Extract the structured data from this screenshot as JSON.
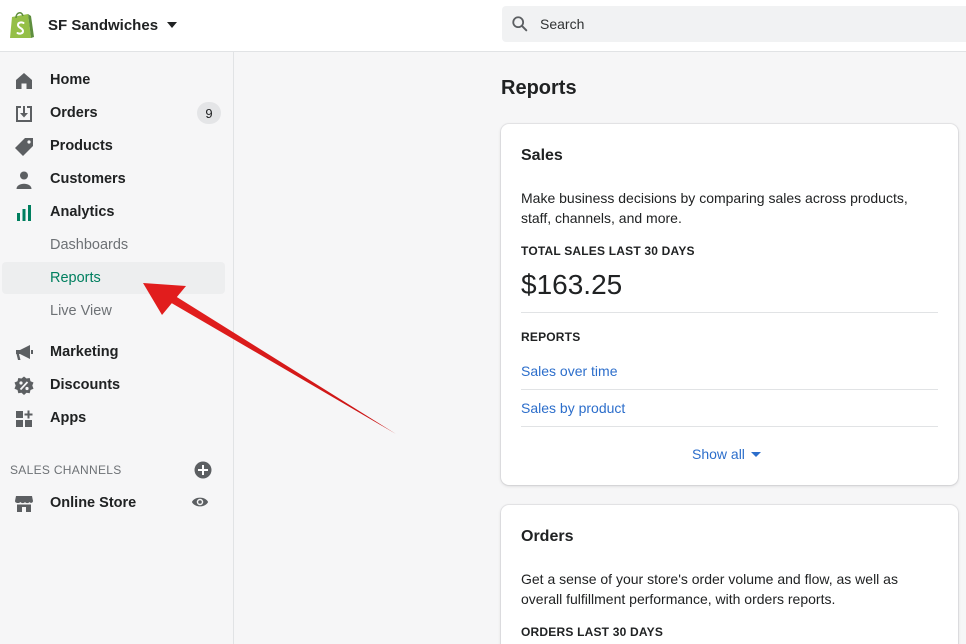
{
  "store": {
    "name": "SF Sandwiches"
  },
  "search": {
    "placeholder": "Search"
  },
  "sidebar": {
    "items": [
      {
        "label": "Home",
        "icon": "home-icon"
      },
      {
        "label": "Orders",
        "icon": "orders-icon",
        "badge": "9"
      },
      {
        "label": "Products",
        "icon": "tag-icon"
      },
      {
        "label": "Customers",
        "icon": "person-icon"
      },
      {
        "label": "Analytics",
        "icon": "bar-chart-icon"
      }
    ],
    "analytics_sub": [
      {
        "label": "Dashboards"
      },
      {
        "label": "Reports",
        "active": true
      },
      {
        "label": "Live View"
      }
    ],
    "more_items": [
      {
        "label": "Marketing",
        "icon": "megaphone-icon"
      },
      {
        "label": "Discounts",
        "icon": "discount-icon"
      },
      {
        "label": "Apps",
        "icon": "apps-icon"
      }
    ],
    "sales_channels": {
      "heading": "SALES CHANNELS",
      "items": [
        {
          "label": "Online Store",
          "icon": "store-icon"
        }
      ]
    }
  },
  "main": {
    "title": "Reports",
    "cards": [
      {
        "title": "Sales",
        "description": "Make business decisions by comparing sales across products, staff, channels, and more.",
        "metric_label": "TOTAL SALES LAST 30 DAYS",
        "metric_value": "$163.25",
        "reports_label": "REPORTS",
        "links": [
          "Sales over time",
          "Sales by product"
        ],
        "show_all": "Show all"
      },
      {
        "title": "Orders",
        "description": "Get a sense of your store's order volume and flow, as well as overall fulfillment performance, with orders reports.",
        "metric_label": "ORDERS LAST 30 DAYS"
      }
    ]
  },
  "colors": {
    "accent_green": "#007f5f",
    "link_blue": "#2c6ecb",
    "annotation_red": "#e02020",
    "shopify_green": "#95bf47"
  }
}
